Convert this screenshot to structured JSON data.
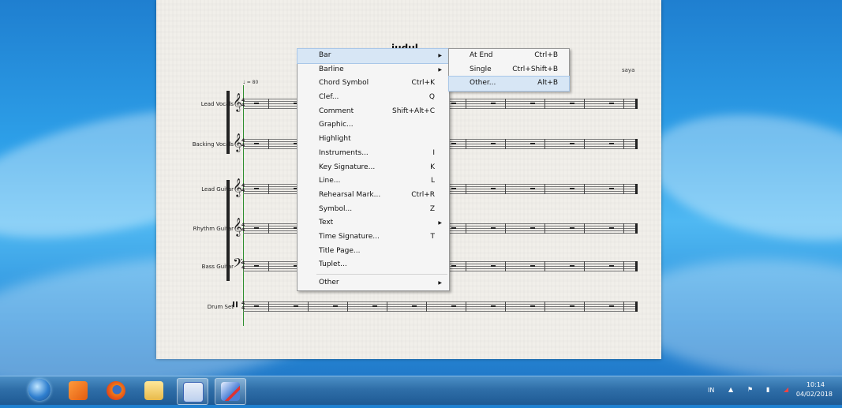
{
  "score": {
    "title": "judul",
    "composer": "saya",
    "tempo": "♩ = 80",
    "instruments": [
      "Lead Vocals",
      "Backing Vocals",
      "Lead Guitar",
      "Rhythm Guitar",
      "Bass Guitar",
      "Drum Set"
    ]
  },
  "context_menu": {
    "items": [
      {
        "label": "Bar",
        "shortcut": "",
        "submenu": true
      },
      {
        "label": "Barline",
        "shortcut": "",
        "submenu": true
      },
      {
        "label": "Chord Symbol",
        "shortcut": "Ctrl+K",
        "submenu": false
      },
      {
        "label": "Clef...",
        "shortcut": "Q",
        "submenu": false
      },
      {
        "label": "Comment",
        "shortcut": "Shift+Alt+C",
        "submenu": false
      },
      {
        "label": "Graphic...",
        "shortcut": "",
        "submenu": false
      },
      {
        "label": "Highlight",
        "shortcut": "",
        "submenu": false
      },
      {
        "label": "Instruments...",
        "shortcut": "I",
        "submenu": false
      },
      {
        "label": "Key Signature...",
        "shortcut": "K",
        "submenu": false
      },
      {
        "label": "Line...",
        "shortcut": "L",
        "submenu": false
      },
      {
        "label": "Rehearsal Mark...",
        "shortcut": "Ctrl+R",
        "submenu": false
      },
      {
        "label": "Symbol...",
        "shortcut": "Z",
        "submenu": false
      },
      {
        "label": "Text",
        "shortcut": "",
        "submenu": true
      },
      {
        "label": "Time Signature...",
        "shortcut": "T",
        "submenu": false
      },
      {
        "label": "Title Page...",
        "shortcut": "",
        "submenu": false
      },
      {
        "label": "Tuplet...",
        "shortcut": "",
        "submenu": false
      },
      {
        "label": "Other",
        "shortcut": "",
        "submenu": true
      }
    ]
  },
  "bar_submenu": {
    "items": [
      {
        "label": "At End",
        "shortcut": "Ctrl+B"
      },
      {
        "label": "Single",
        "shortcut": "Ctrl+Shift+B"
      },
      {
        "label": "Other...",
        "shortcut": "Alt+B"
      }
    ]
  },
  "taskbar": {
    "apps": [
      "media-player-icon",
      "firefox-icon",
      "file-explorer-icon",
      "word-icon",
      "sibelius-icon"
    ],
    "tray_lang": "IN",
    "time": "10:14",
    "date": "04/02/2018"
  }
}
